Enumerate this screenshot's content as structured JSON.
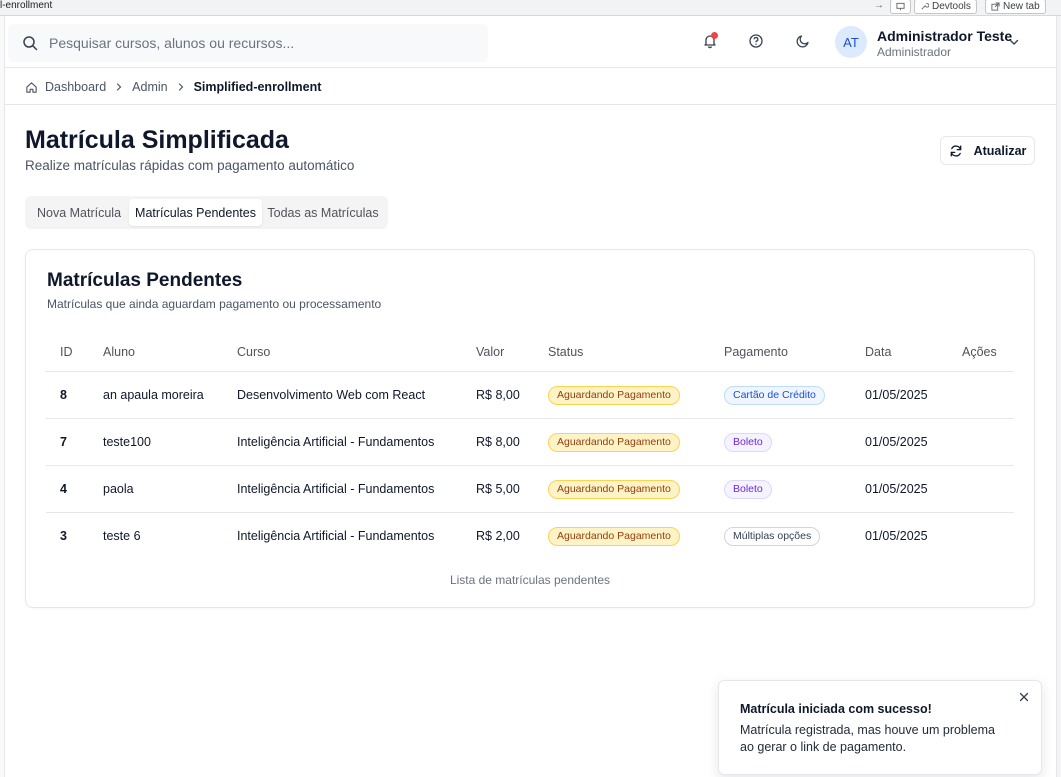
{
  "browser": {
    "url_fragment": "l-enrollment",
    "devtools_label": "Devtools",
    "new_tab_label": "New tab"
  },
  "header": {
    "search_placeholder": "Pesquisar cursos, alunos ou recursos...",
    "avatar_initials": "AT",
    "user_name": "Administrador Teste",
    "user_role": "Administrador",
    "notification_dot_color": "#ef4444",
    "icons": [
      "search-icon",
      "bell-icon",
      "help-icon",
      "moon-icon",
      "chevron-down-icon"
    ]
  },
  "breadcrumb": {
    "items": [
      "Dashboard",
      "Admin",
      "Simplified-enrollment"
    ]
  },
  "page": {
    "title": "Matrícula Simplificada",
    "subtitle": "Realize matrículas rápidas com pagamento automático",
    "refresh_label": "Atualizar"
  },
  "tabs": [
    {
      "label": "Nova Matrícula",
      "active": false
    },
    {
      "label": "Matrículas Pendentes",
      "active": true
    },
    {
      "label": "Todas as Matrículas",
      "active": false
    }
  ],
  "card": {
    "title": "Matrículas Pendentes",
    "description": "Matrículas que ainda aguardam pagamento ou processamento",
    "caption": "Lista de matrículas pendentes"
  },
  "table": {
    "columns": [
      "ID",
      "Aluno",
      "Curso",
      "Valor",
      "Status",
      "Pagamento",
      "Data",
      "Ações"
    ],
    "rows": [
      {
        "id": "8",
        "aluno": "an apaula moreira",
        "curso": "Desenvolvimento Web com React",
        "valor": "R$ 8,00",
        "status": "Aguardando Pagamento",
        "pagamento": "Cartão de Crédito",
        "data": "01/05/2025"
      },
      {
        "id": "7",
        "aluno": "teste100",
        "curso": "Inteligência Artificial - Fundamentos",
        "valor": "R$ 8,00",
        "status": "Aguardando Pagamento",
        "pagamento": "Boleto",
        "data": "01/05/2025"
      },
      {
        "id": "4",
        "aluno": "paola",
        "curso": "Inteligência Artificial - Fundamentos",
        "valor": "R$ 5,00",
        "status": "Aguardando Pagamento",
        "pagamento": "Boleto",
        "data": "01/05/2025"
      },
      {
        "id": "3",
        "aluno": "teste 6",
        "curso": "Inteligência Artificial - Fundamentos",
        "valor": "R$ 2,00",
        "status": "Aguardando Pagamento",
        "pagamento": "Múltiplas opções",
        "data": "01/05/2025"
      }
    ]
  },
  "toast": {
    "title": "Matrícula iniciada com sucesso!",
    "body": "Matrícula registrada, mas houve um problema ao gerar o link de pagamento."
  },
  "colors": {
    "status_badge_bg": "#fef3c7",
    "status_badge_text": "#92400e",
    "card_badge_text": "#1d4ed8",
    "boleto_badge_text": "#6d28d9"
  }
}
